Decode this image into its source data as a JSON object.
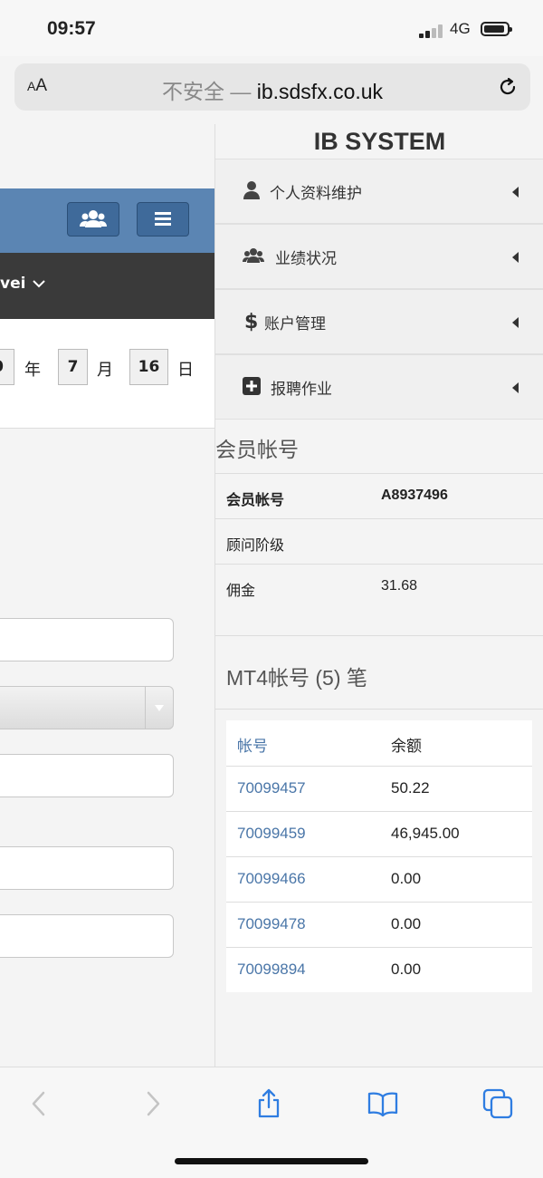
{
  "status": {
    "time": "09:57",
    "network": "4G"
  },
  "browser": {
    "aa_small": "A",
    "aa_large": "A",
    "insecure_label": "不安全 —",
    "domain": "ib.sdsfx.co.uk"
  },
  "left": {
    "user_fragment": "vei",
    "date": {
      "year_fragment": "0",
      "year_label": "年",
      "month": "7",
      "month_label": "月",
      "day": "16",
      "day_label": "日"
    }
  },
  "right": {
    "title": "IB SYSTEM",
    "menu": [
      {
        "label": "个人资料维护",
        "icon": "user-icon"
      },
      {
        "label": "业绩状况",
        "icon": "users-icon"
      },
      {
        "label": "账户管理",
        "icon": "dollar-icon"
      },
      {
        "label": "报聘作业",
        "icon": "plus-square-icon"
      }
    ],
    "member_heading": "会员帐号",
    "member_rows": [
      {
        "label": "会员帐号",
        "value": "A8937496"
      },
      {
        "label": "顾问阶级",
        "value": ""
      },
      {
        "label": "佣金",
        "value": "31.68"
      }
    ],
    "mt4_heading": "MT4帐号 (5) 笔",
    "mt4_columns": [
      "帐号",
      "余额"
    ],
    "mt4_rows": [
      {
        "account": "70099457",
        "balance": "50.22"
      },
      {
        "account": "70099459",
        "balance": "46,945.00"
      },
      {
        "account": "70099466",
        "balance": "0.00"
      },
      {
        "account": "70099478",
        "balance": "0.00"
      },
      {
        "account": "70099894",
        "balance": "0.00"
      }
    ]
  },
  "colors": {
    "header_blue": "#5b85b3",
    "dark_bar": "#3a3a3a",
    "link": "#4a76a8",
    "ios_blue": "#2f7de1"
  }
}
